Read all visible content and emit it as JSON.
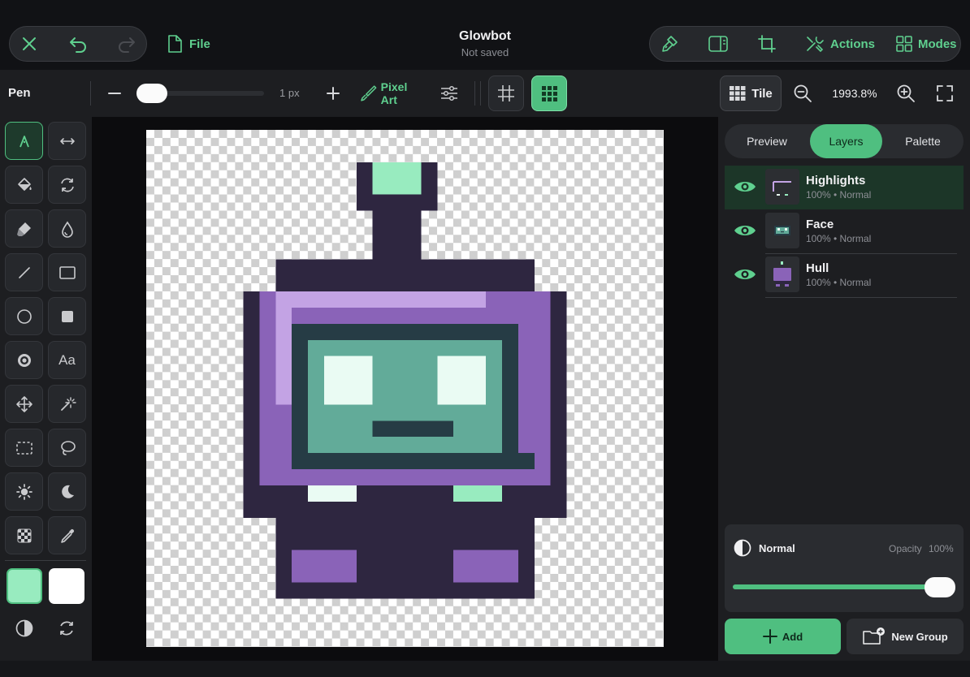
{
  "topbar": {
    "file_label": "File",
    "title": "Glowbot",
    "subtitle": "Not saved",
    "actions_label": "Actions",
    "modes_label": "Modes"
  },
  "options": {
    "tool_name": "Pen",
    "brush_size": "1 px",
    "brush_size_value": 1,
    "pixel_art_label": "Pixel Art",
    "tile_label": "Tile",
    "zoom": "1993.8%"
  },
  "panel": {
    "tabs": [
      "Preview",
      "Layers",
      "Palette"
    ],
    "active_tab": "Layers",
    "layers": [
      {
        "name": "Highlights",
        "meta": "100%  •  Normal",
        "selected": true
      },
      {
        "name": "Face",
        "meta": "100%  •  Normal",
        "selected": false
      },
      {
        "name": "Hull",
        "meta": "100%  •  Normal",
        "selected": false
      }
    ],
    "blend_mode": "Normal",
    "opacity_label": "Opacity",
    "opacity_value": "100%",
    "opacity_fraction": 1.0,
    "add_label": "Add",
    "new_group_label": "New Group"
  },
  "colors": {
    "accent": "#5fd08f",
    "primary_color": "#98ebbf",
    "secondary_color": "#ffffff",
    "robot_outline": "#2e2640",
    "robot_purple": "#8a63b8",
    "robot_light_purple": "#c3a3e4",
    "robot_screen_dark": "#263c45",
    "robot_screen": "#62ab99",
    "robot_mint": "#98ebbf",
    "robot_white": "#eafbf3"
  },
  "tools": [
    "pen-icon",
    "symmetry-icon",
    "fill-bucket-icon",
    "rotate-icon",
    "eraser-icon",
    "dropper-blur-icon",
    "line-icon",
    "rectangle-icon",
    "ellipse-icon",
    "filled-rectangle-icon",
    "circle-target-icon",
    "text-icon",
    "move-icon",
    "magic-wand-icon",
    "rect-select-icon",
    "lasso-icon",
    "brighten-icon",
    "darken-icon",
    "dither-icon",
    "eyedropper-icon"
  ]
}
